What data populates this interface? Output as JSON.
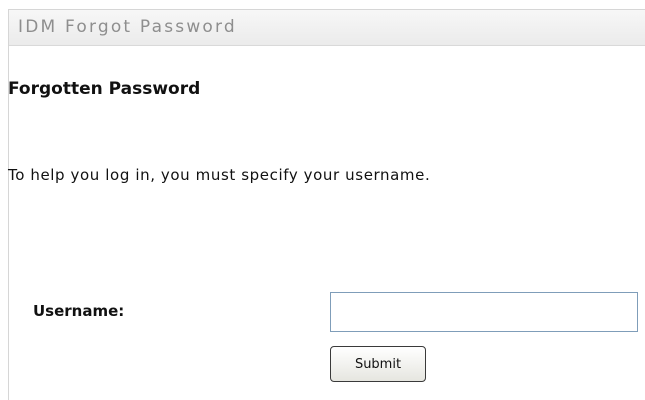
{
  "window": {
    "title": "IDM Forgot Password"
  },
  "form": {
    "heading": "Forgotten Password",
    "instructions": "To help you log in, you must specify your username.",
    "username_label": "Username:",
    "username_value": "",
    "submit_label": "Submit"
  }
}
